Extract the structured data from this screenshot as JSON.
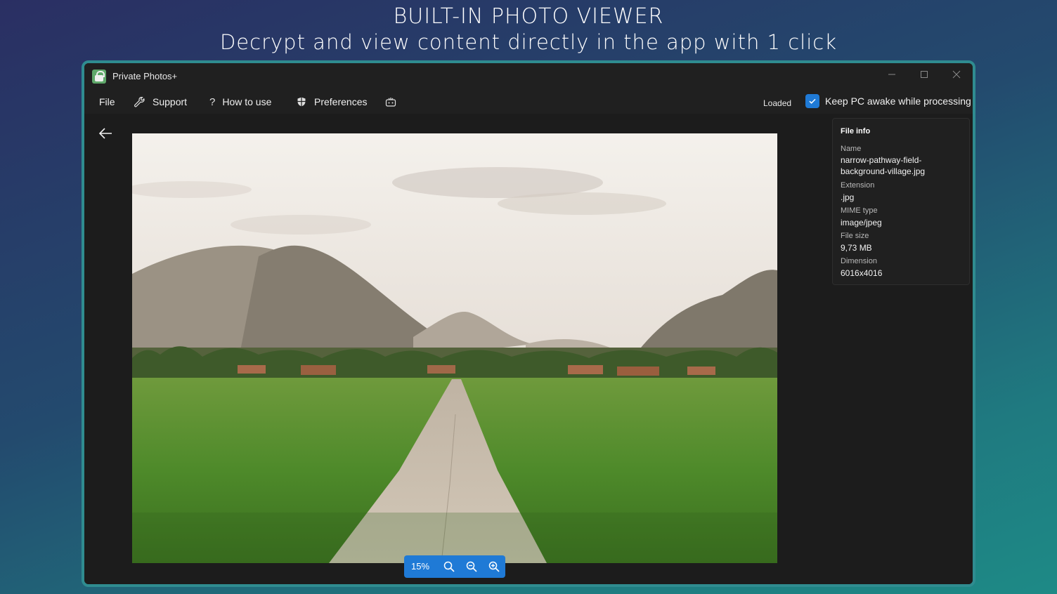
{
  "promo": {
    "title": "BUILT-IN PHOTO VIEWER",
    "subtitle": "Decrypt and view content directly in the app with 1 click"
  },
  "window": {
    "title": "Private Photos+",
    "controls": [
      "minimize-icon",
      "maximize-icon",
      "close-icon"
    ]
  },
  "menu": {
    "file": "File",
    "support": "Support",
    "how_to_use": "How to use",
    "preferences": "Preferences",
    "extra_icon": "feedback-icon"
  },
  "status": {
    "loaded": "Loaded",
    "keep_awake_label": "Keep PC awake while processing",
    "keep_awake_checked": true
  },
  "viewer": {
    "zoom_level": "15%",
    "image_alt": "narrow-pathway-field-background-village"
  },
  "file_info": {
    "title": "File info",
    "name_label": "Name",
    "name_line1": "narrow-pathway-field-",
    "name_line2": "background-village.jpg",
    "extension_label": "Extension",
    "extension": ".jpg",
    "mime_label": "MIME type",
    "mime": "image/jpeg",
    "size_label": "File size",
    "size": "9,73 MB",
    "dimension_label": "Dimension",
    "dimension": "6016x4016"
  },
  "colors": {
    "accent": "#1f7ad6",
    "window_border": "#2f8c90",
    "window_bg": "#202020"
  }
}
